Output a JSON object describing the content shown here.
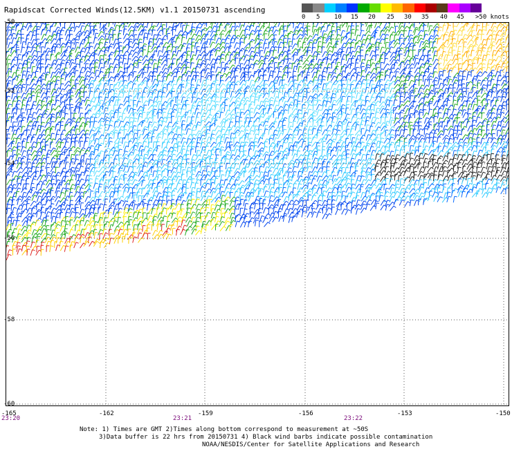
{
  "title": "Rapidscat Corrected Winds(12.5KM) v1.1 20150731 ascending",
  "legend": {
    "colors": [
      "#555555",
      "#888888",
      "#00d0ff",
      "#0080ff",
      "#0033ff",
      "#00aa00",
      "#66dd00",
      "#ffff00",
      "#ffbb00",
      "#ff6600",
      "#ff0000",
      "#aa0000",
      "#5a3a1a",
      "#ff00ff",
      "#aa00ff",
      "#660099"
    ],
    "ticks": [
      "0",
      "5",
      "10",
      "15",
      "20",
      "25",
      "30",
      "35",
      "40",
      "45",
      ">50 knots"
    ]
  },
  "axes": {
    "y_ticks": [
      "-50",
      "-52",
      "-54",
      "-56",
      "-58",
      "-60"
    ],
    "x_ticks": [
      "-165",
      "-162",
      "-159",
      "-156",
      "-153",
      "-150"
    ],
    "time_labels": [
      "23:20",
      "23:21",
      "23:22"
    ]
  },
  "notes": {
    "line1": "Note: 1) Times are GMT 2)Times along bottom correspond to measurement at ~50S",
    "line2": "3)Data buffer is 22 hrs from 20150731 4) Black wind barbs indicate possible contamination",
    "line3": "NOAA/NESDIS/Center for Satellite Applications and Research"
  }
}
